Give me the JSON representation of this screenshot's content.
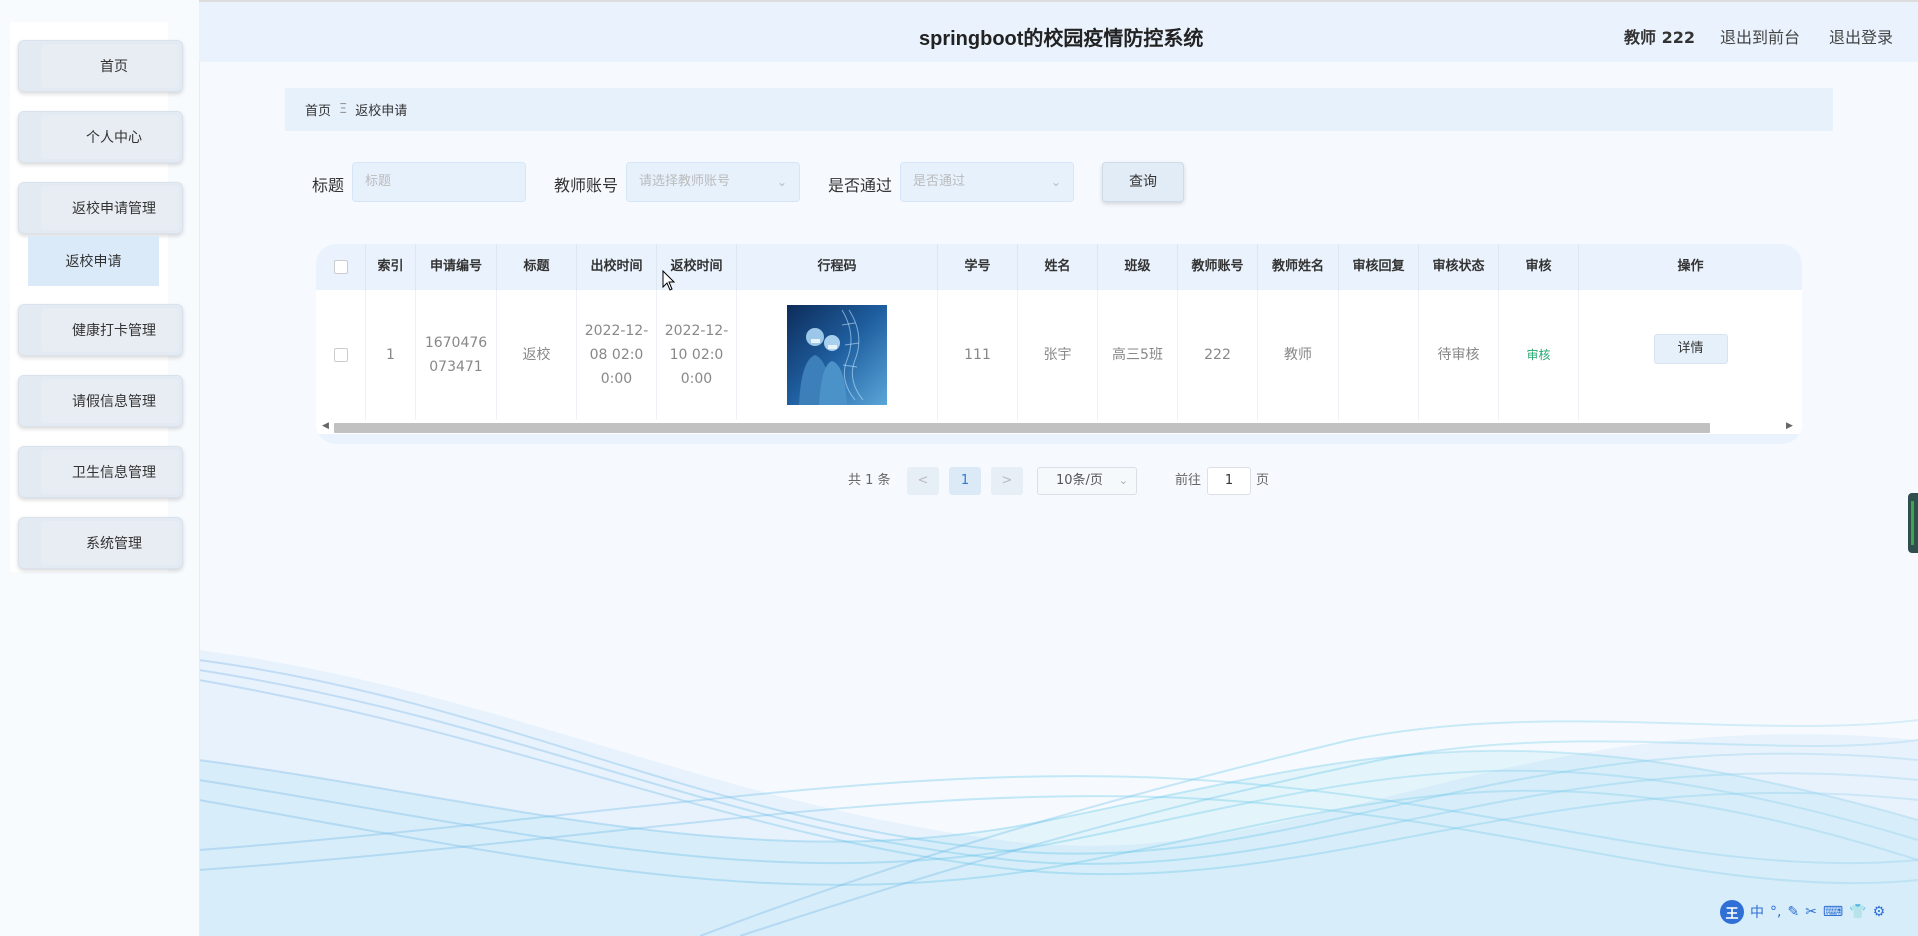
{
  "header": {
    "title": "springboot的校园疫情防控系统",
    "user": "教师 222",
    "link_front": "退出到前台",
    "link_logout": "退出登录"
  },
  "sidebar": {
    "items": [
      {
        "label": "首页"
      },
      {
        "label": "个人中心"
      },
      {
        "label": "返校申请管理"
      },
      {
        "label": "健康打卡管理"
      },
      {
        "label": "请假信息管理"
      },
      {
        "label": "卫生信息管理"
      },
      {
        "label": "系统管理"
      }
    ],
    "submenu_label": "返校申请"
  },
  "breadcrumb": {
    "home": "首页",
    "sep": "Ξ",
    "current": "返校申请"
  },
  "search": {
    "title_label": "标题",
    "title_placeholder": "标题",
    "account_label": "教师账号",
    "account_placeholder": "请选择教师账号",
    "pass_label": "是否通过",
    "pass_placeholder": "是否通过",
    "button": "查询"
  },
  "table": {
    "headers": [
      "索引",
      "申请编号",
      "标题",
      "出校时间",
      "返校时间",
      "行程码",
      "学号",
      "姓名",
      "班级",
      "教师账号",
      "教师姓名",
      "审核回复",
      "审核状态",
      "审核",
      "操作"
    ],
    "row": {
      "index": "1",
      "apply_no": "1670476073471",
      "title": "返校",
      "out_time": "2022-12-08 02:00:00",
      "return_time": "2022-12-10 02:00:00",
      "student_no": "111",
      "name": "张宇",
      "class": "高三5班",
      "teacher_account": "222",
      "teacher_name": "教师",
      "reply": "",
      "status": "待审核",
      "audit_link": "审核",
      "detail_button": "详情"
    }
  },
  "pager": {
    "total": "共 1 条",
    "prev": "<",
    "page": "1",
    "next": ">",
    "page_size": "10条/页",
    "goto_prefix": "前往",
    "goto_value": "1",
    "goto_suffix": "页"
  },
  "ime": {
    "logo": "王",
    "lang": "中",
    "icons": [
      "°,",
      "✎",
      "✂",
      "⌨",
      "👕",
      "⚙"
    ]
  },
  "colors": {
    "accent": "#2b7cd3",
    "header_bg": "#eaf3fd",
    "pass_green": "#2aa773"
  }
}
